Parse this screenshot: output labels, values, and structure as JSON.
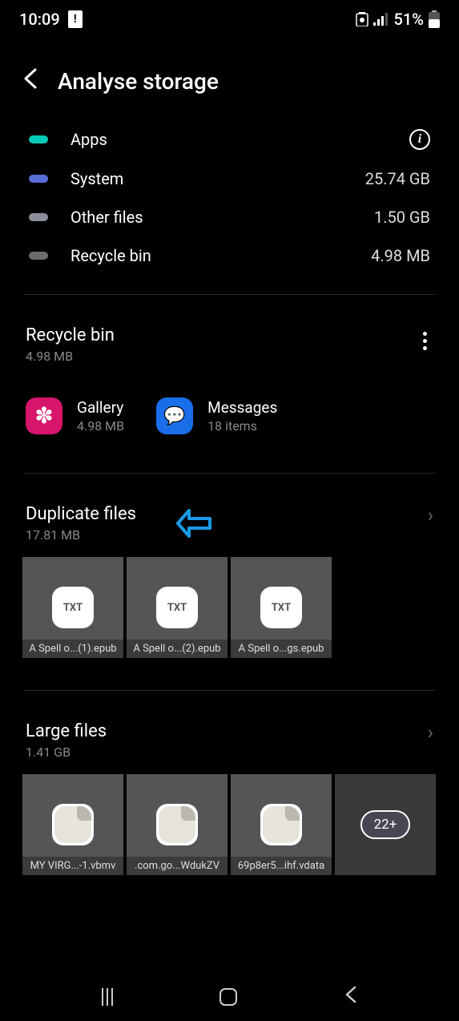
{
  "status": {
    "time": "10:09",
    "battery": "51%"
  },
  "header": {
    "title": "Analyse storage"
  },
  "categories": [
    {
      "color": "pill-apps",
      "label": "Apps",
      "value": "",
      "info": true
    },
    {
      "color": "pill-system",
      "label": "System",
      "value": "25.74 GB",
      "info": false
    },
    {
      "color": "pill-other",
      "label": "Other files",
      "value": "1.50 GB",
      "info": false
    },
    {
      "color": "pill-recycle",
      "label": "Recycle bin",
      "value": "4.98 MB",
      "info": false
    }
  ],
  "recycle": {
    "title": "Recycle bin",
    "size": "4.98 MB",
    "items": [
      {
        "icon": "gallery",
        "label": "Gallery",
        "sub": "4.98 MB"
      },
      {
        "icon": "messages",
        "label": "Messages",
        "sub": "18 items"
      }
    ]
  },
  "duplicates": {
    "title": "Duplicate files",
    "size": "17.81 MB",
    "files": [
      {
        "type": "TXT",
        "name": "A Spell o...(1).epub"
      },
      {
        "type": "TXT",
        "name": "A Spell o...(2).epub"
      },
      {
        "type": "TXT",
        "name": "A Spell o...gs.epub"
      }
    ]
  },
  "large": {
    "title": "Large files",
    "size": "1.41 GB",
    "files": [
      {
        "type": "file",
        "name": "MY VIRG...-1.vbmv"
      },
      {
        "type": "file",
        "name": ".com.go...WdukZV"
      },
      {
        "type": "file",
        "name": "69p8er5...ihf.vdata"
      }
    ],
    "more": "22+"
  }
}
